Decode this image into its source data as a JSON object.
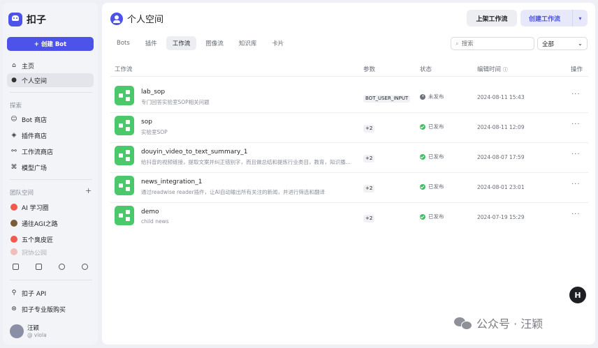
{
  "app": {
    "name": "扣子"
  },
  "sidebar": {
    "create_bot": "+ 创建 Bot",
    "nav": [
      {
        "label": "主页",
        "icon": "home-icon"
      },
      {
        "label": "个人空间",
        "icon": "user-icon"
      }
    ],
    "explore_title": "探索",
    "explore": [
      {
        "label": "Bot 商店",
        "icon": "bot-store-icon"
      },
      {
        "label": "插件商店",
        "icon": "plugin-store-icon"
      },
      {
        "label": "工作流商店",
        "icon": "workflow-store-icon"
      },
      {
        "label": "模型广场",
        "icon": "model-plaza-icon"
      }
    ],
    "team_title": "团队空间",
    "teams": [
      {
        "label": "AI 学习圈"
      },
      {
        "label": "通往AGI之路"
      },
      {
        "label": "五个臭皮匠"
      },
      {
        "label": "冠协公园"
      }
    ],
    "bottom_links": [
      {
        "label": "扣子 API",
        "icon": "api-icon"
      },
      {
        "label": "扣子专业版购买",
        "icon": "pro-purchase-icon"
      }
    ],
    "user": {
      "name": "汪颖",
      "handle": "@ viola"
    }
  },
  "header": {
    "title": "个人空间",
    "publish_button": "上架工作流",
    "create_button": "创建工作流"
  },
  "tabs": [
    "Bots",
    "插件",
    "工作流",
    "图像流",
    "知识库",
    "卡片"
  ],
  "active_tab": "工作流",
  "search": {
    "placeholder": "搜索"
  },
  "filter": {
    "value": "全部"
  },
  "table": {
    "columns": [
      "工作流",
      "参数",
      "状态",
      "编辑时间",
      "操作"
    ],
    "rows": [
      {
        "name": "lab_sop",
        "desc": "专门回答实验室SOP相关问题",
        "param": "BOT_USER_INPUT",
        "status": "未发布",
        "published": false,
        "time": "2024-08-11 15:43",
        "action": "···"
      },
      {
        "name": "sop",
        "desc": "实验室SOP",
        "param": "+2",
        "status": "已发布",
        "published": true,
        "time": "2024-08-11 12:09",
        "action": "···"
      },
      {
        "name": "douyin_video_to_text_summary_1",
        "desc": "给抖音的视频链接，提取文案并纠正错别字，而且做总结和提炼行业类目，教育，知识播主或...",
        "param": "+2",
        "status": "已发布",
        "published": true,
        "time": "2024-08-07 17:59",
        "action": "···"
      },
      {
        "name": "news_integration_1",
        "desc": "通过readwise reader插件，让AI自动输出所有关注的新闻，并进行筛选和翻译",
        "param": "+2",
        "status": "已发布",
        "published": true,
        "time": "2024-08-01 23:01",
        "action": "···"
      },
      {
        "name": "demo",
        "desc": "child news",
        "param": "+2",
        "status": "已发布",
        "published": true,
        "time": "2024-07-19 15:29",
        "action": "···"
      }
    ]
  },
  "float_button": "H",
  "watermark": "公众号 · 汪颖",
  "colors": {
    "accent": "#4d53e8",
    "workflow_icon": "#4bc86a",
    "published": "#3dbf64"
  }
}
